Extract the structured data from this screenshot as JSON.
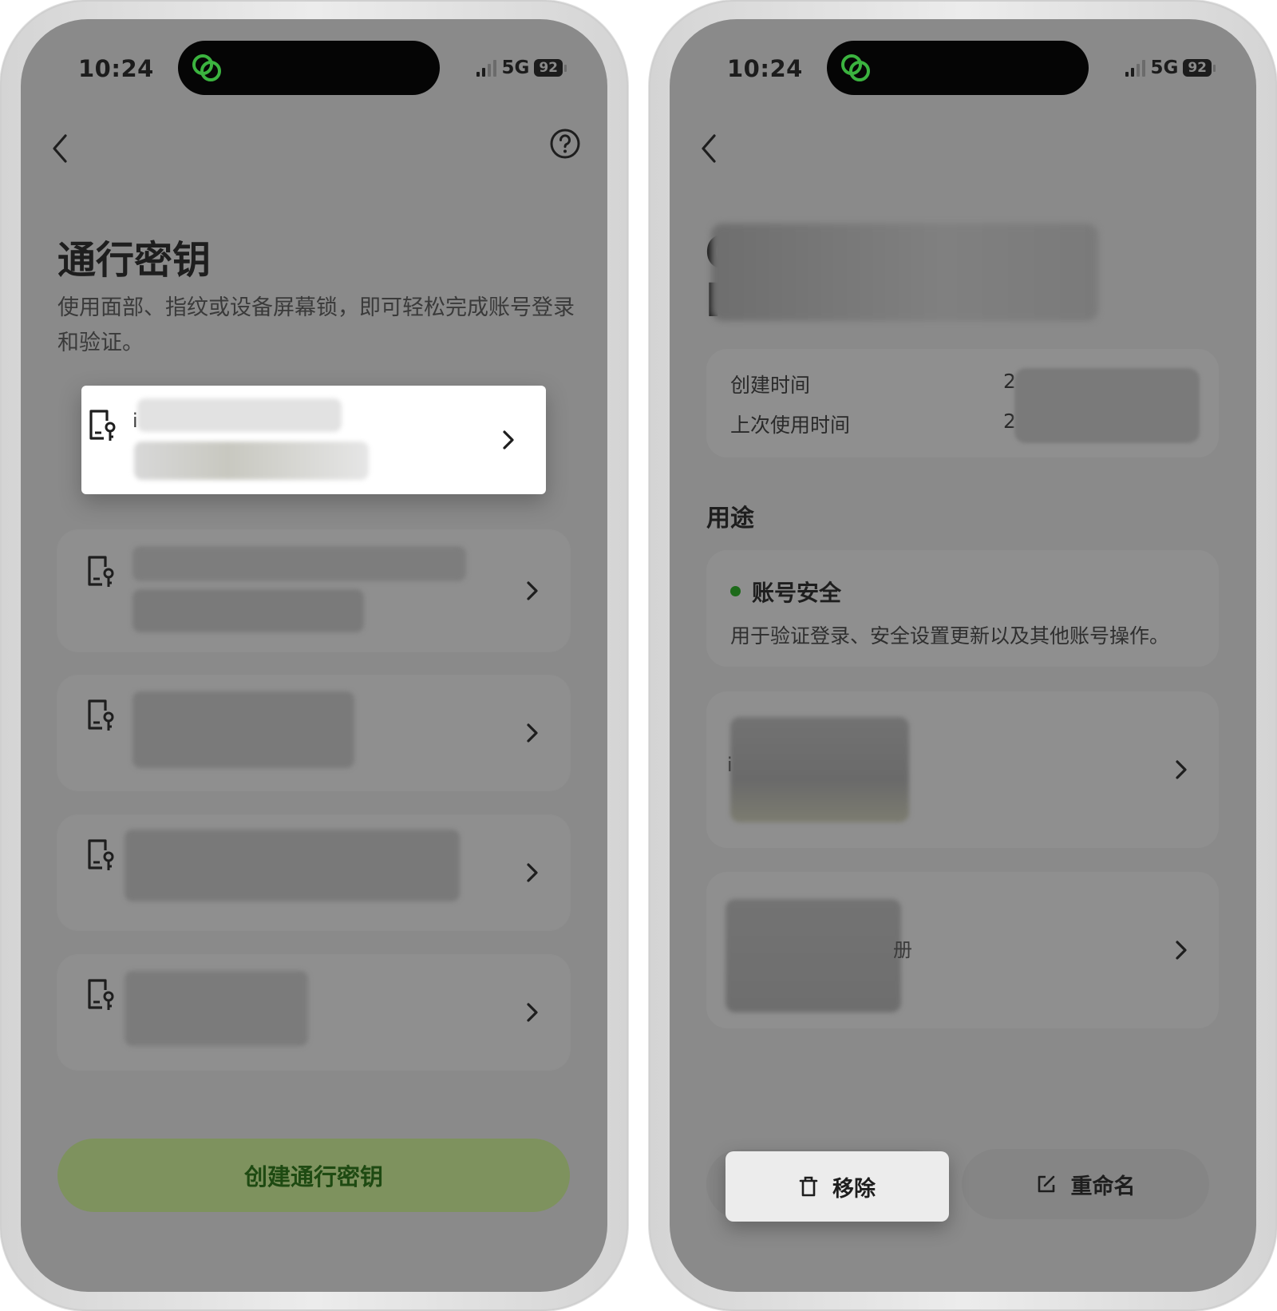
{
  "status_bar": {
    "time": "10:24",
    "network": "5G",
    "battery": "92"
  },
  "left": {
    "title": "通行密钥",
    "subtitle": "使用面部、指纹或设备屏幕锁，即可轻松完成账号登录和验证。",
    "passkeys": [
      {
        "peek": "i",
        "highlighted": true
      },
      {
        "peek": "",
        "highlighted": false
      },
      {
        "peek": "",
        "highlighted": false
      },
      {
        "peek": "",
        "highlighted": false
      },
      {
        "peek": "",
        "highlighted": false
      }
    ],
    "create_button": "创建通行密钥"
  },
  "right": {
    "name_peek": [
      "C",
      "I"
    ],
    "info": {
      "created_label": "创建时间",
      "created_value_peek": "2",
      "last_used_label": "上次使用时间",
      "last_used_value_peek": "2"
    },
    "usage_heading": "用途",
    "purposes": [
      {
        "title": "账号安全",
        "description": "用于验证登录、安全设置更新以及其他账号操作。"
      }
    ],
    "device_cards": [
      {
        "peek": "i"
      },
      {
        "peek": "册"
      }
    ],
    "remove_label": "移除",
    "rename_label": "重命名"
  },
  "colors": {
    "screen_bg": "#8a8a8a",
    "accent_green": "#1d6a1a",
    "create_button_bg": "#7e925e",
    "island_icon": "#3bb33f"
  },
  "icons": {
    "back": "chevron-left-icon",
    "help": "question-circle-icon",
    "passkey": "passkey-device-icon",
    "row_arrow": "chevron-right-icon",
    "delete": "trash-icon",
    "rename": "edit-icon",
    "island": "linked-rings-icon"
  }
}
